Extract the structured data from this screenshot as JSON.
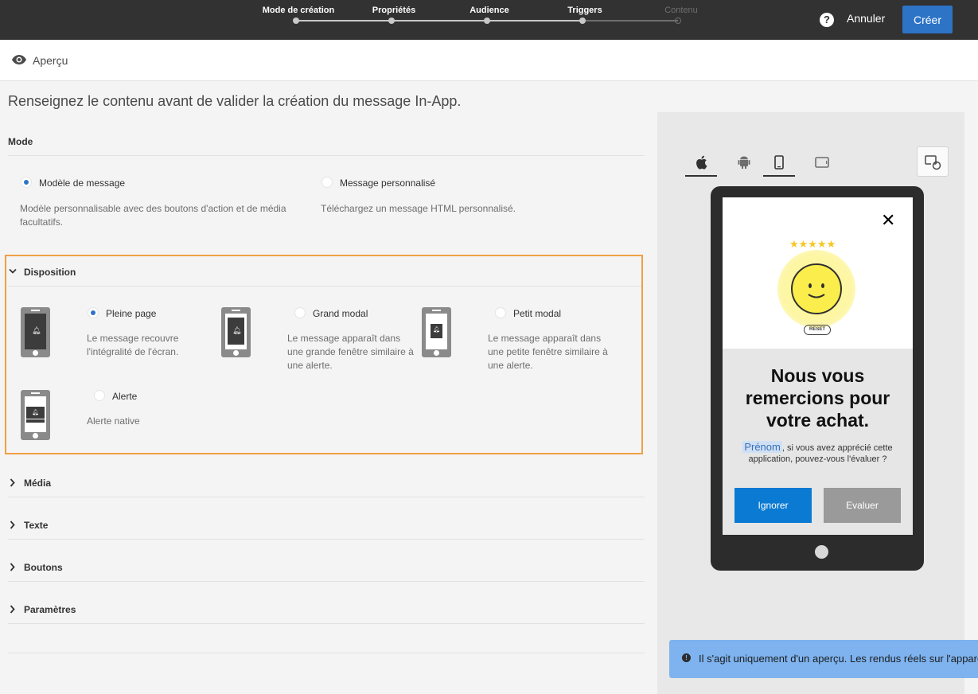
{
  "header": {
    "steps": [
      {
        "label": "Mode de création",
        "state": "done"
      },
      {
        "label": "Propriétés",
        "state": "done"
      },
      {
        "label": "Audience",
        "state": "done"
      },
      {
        "label": "Triggers",
        "state": "done"
      },
      {
        "label": "Contenu",
        "state": "current"
      }
    ],
    "help_label": "?",
    "cancel_label": "Annuler",
    "create_label": "Créer"
  },
  "preview": {
    "label": "Aperçu"
  },
  "intro": "Renseignez le contenu avant de valider la création du message In-App.",
  "mode": {
    "title": "Mode",
    "options": [
      {
        "label": "Modèle de message",
        "desc": "Modèle personnalisable avec des boutons d'action et de média facultatifs.",
        "checked": true
      },
      {
        "label": "Message personnalisé",
        "desc": "Téléchargez un message HTML personnalisé.",
        "checked": false
      }
    ]
  },
  "disposition": {
    "title": "Disposition",
    "options": [
      {
        "label": "Pleine page",
        "desc": "Le message recouvre l'intégralité de l'écran.",
        "checked": true
      },
      {
        "label": "Grand modal",
        "desc": "Le message apparaît dans une grande fenêtre similaire à une alerte.",
        "checked": false
      },
      {
        "label": "Petit modal",
        "desc": "Le message apparaît dans une petite fenêtre similaire à une alerte.",
        "checked": false
      },
      {
        "label": "Alerte",
        "desc": "Alerte native",
        "checked": false
      }
    ]
  },
  "sections": [
    "Média",
    "Texte",
    "Boutons",
    "Paramètres"
  ],
  "device_preview": {
    "tabs": [
      "apple-icon",
      "android-icon",
      "phone-portrait-icon",
      "phone-landscape-icon"
    ],
    "active_os": "apple-icon",
    "active_orientation": "phone-portrait-icon",
    "close": "✕",
    "stars": "★★★★★",
    "reset": "RESET",
    "title": "Nous vous remercions pour votre achat.",
    "firstname": "Prénom",
    "body": ", si vous avez apprécié cette application, pouvez-vous l'évaluer ?",
    "ignore_label": "Ignorer",
    "rate_label": "Evaluer"
  },
  "info": "Il s'agit uniquement d'un aperçu. Les rendus réels sur l'appareil peuvent varier.",
  "colors": {
    "accent": "#2d74c7",
    "highlight": "#f0a046",
    "topbar": "#323232"
  }
}
